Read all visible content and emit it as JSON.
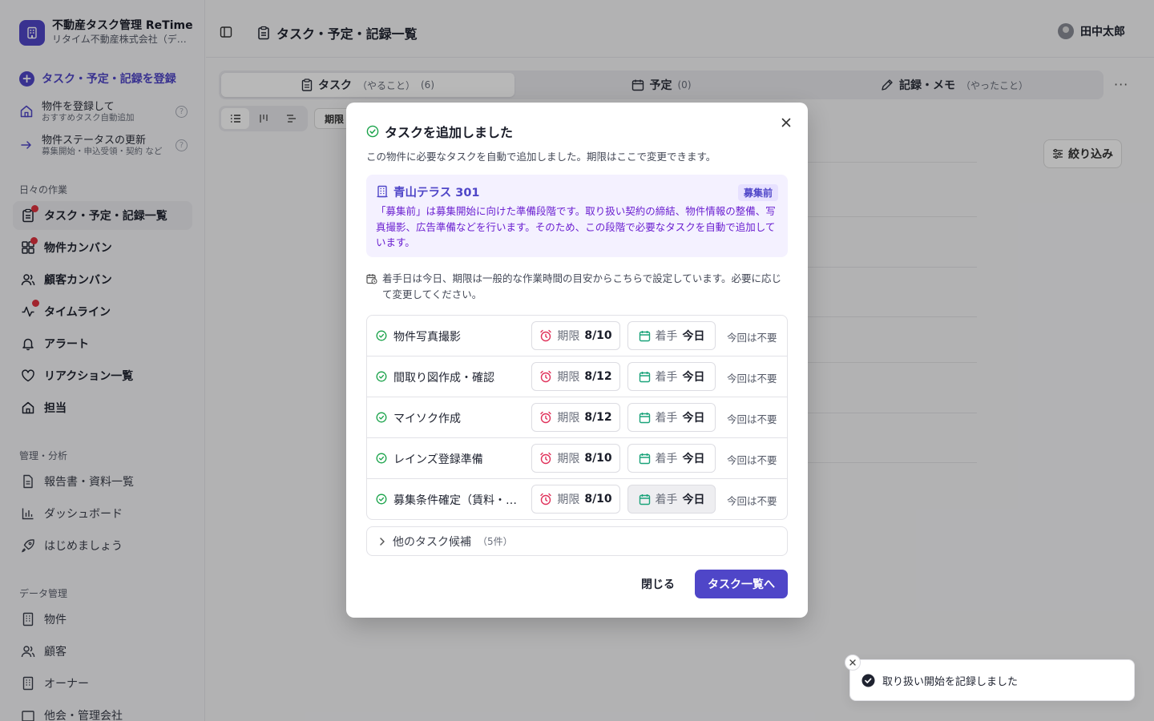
{
  "brand": {
    "title": "不動産タスク管理 ReTime",
    "subtitle": "リタイム不動産株式会社（デモ）"
  },
  "sidebar": {
    "primary_action": "タスク・予定・記録を登録",
    "help_items": [
      {
        "title": "物件を登録して",
        "sub": "おすすめタスク自動追加"
      },
      {
        "title": "物件ステータスの更新",
        "sub": "募集開始・申込受領・契約 など"
      }
    ],
    "sections": {
      "daily": "日々の作業",
      "manage": "管理・分析",
      "data": "データ管理"
    },
    "daily_items": [
      {
        "label": "タスク・予定・記録一覧"
      },
      {
        "label": "物件カンバン"
      },
      {
        "label": "顧客カンバン"
      },
      {
        "label": "タイムライン"
      },
      {
        "label": "アラート"
      },
      {
        "label": "リアクション一覧"
      },
      {
        "label": "担当"
      }
    ],
    "manage_items": [
      {
        "label": "報告書・資料一覧"
      },
      {
        "label": "ダッシュボード"
      },
      {
        "label": "はじめましょう"
      }
    ],
    "data_items": [
      {
        "label": "物件"
      },
      {
        "label": "顧客"
      },
      {
        "label": "オーナー"
      },
      {
        "label": "他会・管理会社"
      }
    ]
  },
  "header": {
    "title": "タスク・予定・記録一覧",
    "user": "田中太郎"
  },
  "tabs": [
    {
      "label": "タスク",
      "sub": "（やること）",
      "count": "(6)"
    },
    {
      "label": "予定",
      "sub": "",
      "count": "(0)"
    },
    {
      "label": "記録・メモ",
      "sub": "（やったこと）",
      "count": ""
    }
  ],
  "toolbar": {
    "chip": "期限",
    "filter": "絞り込み",
    "more": "···"
  },
  "modal": {
    "title": "タスクを追加しました",
    "description": "この物件に必要なタスクを自動で追加しました。期限はここで変更できます。",
    "property": {
      "name": "青山テラス 301",
      "status": "募集前",
      "text": "「募集前」は募集開始に向けた準備段階です。取り扱い契約の締結、物件情報の整備、写真撮影、広告準備などを行います。そのため、この段階で必要なタスクを自動で追加しています。"
    },
    "note": "着手日は今日、期限は一般的な作業時間の目安からこちらで設定しています。必要に応じて変更してください。",
    "due_label": "期限",
    "start_label": "着手",
    "skip_label": "今回は不要",
    "tasks": [
      {
        "name": "物件写真撮影",
        "due": "8/10",
        "start": "今日"
      },
      {
        "name": "間取り図作成・確認",
        "due": "8/12",
        "start": "今日"
      },
      {
        "name": "マイソク作成",
        "due": "8/12",
        "start": "今日"
      },
      {
        "name": "レインズ登録準備",
        "due": "8/10",
        "start": "今日"
      },
      {
        "name": "募集条件確定（賃料・敷金・礼金）",
        "due": "8/10",
        "start": "今日"
      }
    ],
    "more_candidates": "他のタスク候補",
    "more_count": "（5件）",
    "close_button": "閉じる",
    "primary_button": "タスク一覧へ"
  },
  "toast": {
    "message": "取り扱い開始を記録しました"
  },
  "colors": {
    "accent": "#4f46c8",
    "due": "#e0315a",
    "start": "#1aa37a",
    "check": "#1aa34a"
  }
}
